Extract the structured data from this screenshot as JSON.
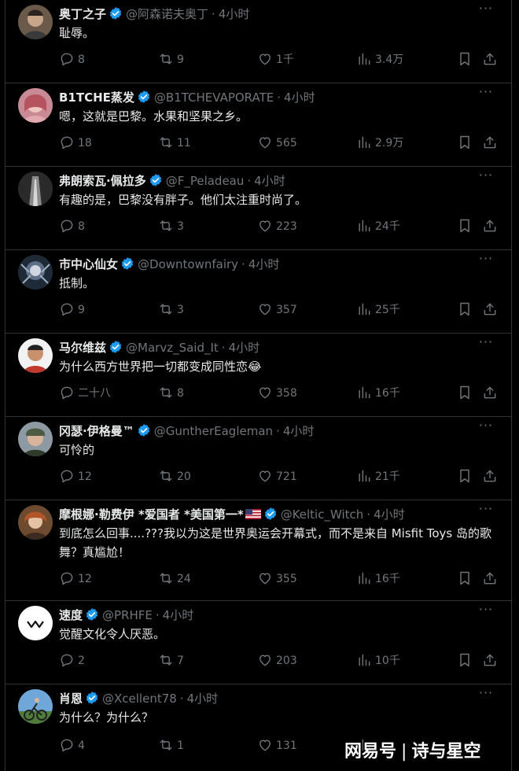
{
  "tweets": [
    {
      "name": "奥丁之子",
      "handle": "@阿森诺夫奥丁",
      "time": "4小时",
      "text": "耻辱。",
      "reply": "8",
      "retweet": "9",
      "like": "1千",
      "views": "3.4万"
    },
    {
      "name": "B1TCHE蒸发",
      "handle": "@B1TCHEVAPORATE",
      "time": "4小时",
      "text": "嗯，这就是巴黎。水果和坚果之乡。",
      "reply": "18",
      "retweet": "11",
      "like": "565",
      "views": "2.9万"
    },
    {
      "name": "弗朗索瓦·佩拉多",
      "handle": "@F_Peladeau",
      "time": "4小时",
      "text": "有趣的是，巴黎没有胖子。他们太注重时尚了。",
      "reply": "8",
      "retweet": "3",
      "like": "223",
      "views": "24千"
    },
    {
      "name": "市中心仙女",
      "handle": "@Downtownfairy",
      "time": "4小时",
      "text": "抵制。",
      "reply": "9",
      "retweet": "3",
      "like": "357",
      "views": "25千"
    },
    {
      "name": "马尔维兹",
      "handle": "@Marvz_Said_It",
      "time": "4小时",
      "text": "为什么西方世界把一切都变成同性恋😂",
      "reply": "二十八",
      "retweet": "8",
      "like": "358",
      "views": "16千"
    },
    {
      "name": "冈瑟·伊格曼™",
      "handle": "@GuntherEagleman",
      "time": "4小时",
      "text": "可怜的",
      "reply": "12",
      "retweet": "20",
      "like": "721",
      "views": "21千"
    },
    {
      "name": "摩根娜·勒费伊 *爱国者 *美国第一*",
      "handle": "@Keltic_Witch",
      "time": "4小时",
      "text": "到底怎么回事....???我以为这是世界奥运会开幕式，而不是来自 Misfit Toys 岛的歌舞？真尴尬！",
      "reply": "12",
      "retweet": "24",
      "like": "355",
      "views": "16千"
    },
    {
      "name": "速度",
      "handle": "@PRHFE",
      "time": "4小时",
      "text": "觉醒文化令人厌恶。",
      "reply": "2",
      "retweet": "7",
      "like": "203",
      "views": "10千"
    },
    {
      "name": "肖恩",
      "handle": "@Xcellent78",
      "time": "4小时",
      "text": "为什么？为什么？",
      "reply": "4",
      "retweet": "1",
      "like": "131",
      "views": ""
    }
  ],
  "separator": "·",
  "more_glyph": "···",
  "watermark": {
    "left": "网易号",
    "bar": "|",
    "right": "诗与星空"
  },
  "colors": {
    "background": "#000000",
    "text": "#e7e9ea",
    "muted": "#71767b",
    "verified": "#1d9bf0",
    "border": "#2f3336"
  },
  "icons": [
    "reply-icon",
    "retweet-icon",
    "like-icon",
    "views-icon",
    "bookmark-icon",
    "share-icon",
    "verified-badge-icon",
    "more-icon",
    "us-flag-icon"
  ]
}
